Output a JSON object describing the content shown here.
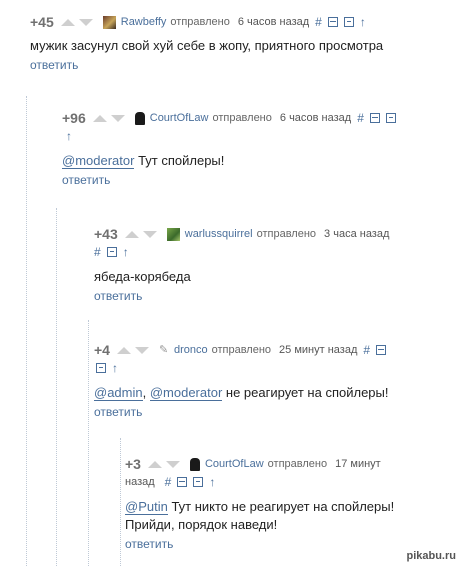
{
  "reply_label": "ответить",
  "watermark": "pikabu.ru",
  "comments": [
    {
      "rating": "+45",
      "user": "Rawbeffy",
      "sent": "отправлено",
      "time": "6 часов назад",
      "hash": "#",
      "body": "мужик засунул свой хуй себе в жопу, приятного просмотра"
    },
    {
      "rating": "+96",
      "user": "CourtOfLaw",
      "sent": "отправлено",
      "time": "6 часов назад",
      "hash": "#",
      "mention1": "@moderator",
      "body": " Тут спойлеры!"
    },
    {
      "rating": "+43",
      "user": "warlussquirrel",
      "sent": "отправлено",
      "time": "3 часа назад",
      "hash": "#",
      "body": "ябеда-корябеда"
    },
    {
      "rating": "+4",
      "user": "dronco",
      "sent": "отправлено",
      "time": "25 минут назад",
      "hash": "#",
      "mention1": "@admin",
      "sep": ", ",
      "mention2": "@moderator",
      "body": " не реагирует на спойлеры!"
    },
    {
      "rating": "+3",
      "user": "CourtOfLaw",
      "sent": "отправлено",
      "time": "17 минут",
      "time2": "назад",
      "hash": "#",
      "mention1": "@Putin",
      "body": " Тут никто не реагирует на спойлеры!",
      "body2": "Прийди, порядок наведи!"
    }
  ]
}
